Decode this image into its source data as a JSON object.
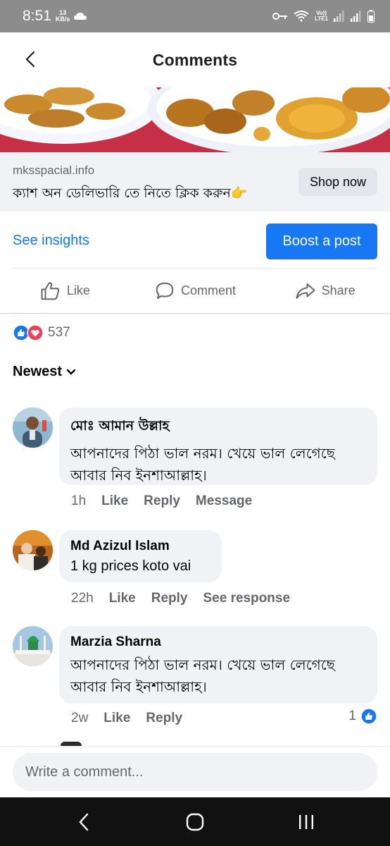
{
  "status_bar": {
    "time": "8:51",
    "net_speed_value": "13",
    "net_speed_unit": "KB/s",
    "volte_top": "Vo))",
    "volte_bottom": "LTE1"
  },
  "header": {
    "title": "Comments"
  },
  "ad": {
    "domain": "mksspacial.info",
    "text": "ক্যাশ অন ডেলিভারি তে নিতে ক্লিক করুন👉",
    "shop_button": "Shop now"
  },
  "insights": {
    "see_insights": "See insights",
    "boost_button": "Boost a post"
  },
  "actions": {
    "like": "Like",
    "comment": "Comment",
    "share": "Share"
  },
  "reactions": {
    "count": "537"
  },
  "sort": {
    "label": "Newest"
  },
  "comments": [
    {
      "author": "মোঃ আমান উল্লাহ",
      "text": "আপনাদের পিঠা ভাল নরম। খেয়ে ভাল লেগেছে আবার নিব ইনশাআল্লাহ।",
      "time": "1h",
      "like": "Like",
      "reply": "Reply",
      "extra": "Message"
    },
    {
      "author": "Md Azizul Islam",
      "text": "1 kg prices koto vai",
      "time": "22h",
      "like": "Like",
      "reply": "Reply",
      "extra": "See response"
    },
    {
      "author": "Marzia Sharna",
      "text": "আপনাদের পিঠা ভাল নরম। খেয়ে ভাল লেগেছে আবার নিব ইনশাআল্লাহ।",
      "time": "2w",
      "like": "Like",
      "reply": "Reply",
      "like_count": "1"
    }
  ],
  "composer": {
    "placeholder": "Write a comment..."
  },
  "colors": {
    "accent": "#1877f2",
    "bubble": "#f0f2f5",
    "secondary_text": "#65676b",
    "status_bar": "#8c8c8c",
    "nav_bar": "#111111"
  },
  "icons": [
    "back-arrow-icon",
    "like-icon",
    "comment-icon",
    "share-icon",
    "chevron-down-icon",
    "like-reaction-icon",
    "love-reaction-icon"
  ]
}
